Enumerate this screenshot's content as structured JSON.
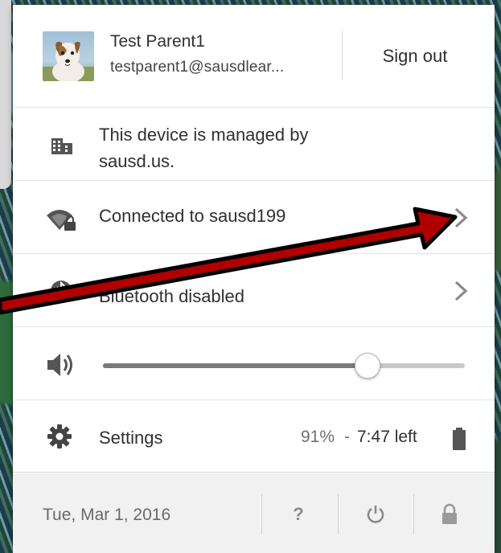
{
  "user": {
    "name": "Test Parent1",
    "email": "testparent1@sausdlear...",
    "sign_out_label": "Sign out"
  },
  "managed": {
    "text": "This device is managed by sausd.us.",
    "icon": "building-icon"
  },
  "network": {
    "label": "Connected to sausd199",
    "icon": "wifi-lock-icon"
  },
  "bluetooth": {
    "label": "Bluetooth disabled",
    "icon": "bluetooth-disabled-icon"
  },
  "volume": {
    "icon": "speaker-icon",
    "level": 0.73
  },
  "settings": {
    "label": "Settings",
    "battery_percent": "91%",
    "separator": "-",
    "battery_time": "7:47 left"
  },
  "footer": {
    "date": "Tue, Mar 1, 2016",
    "help_glyph": "?",
    "power_icon": "power-icon",
    "lock_icon": "lock-icon"
  },
  "colors": {
    "text": "#303030",
    "muted": "#707070",
    "arrow": "#b00000",
    "footer_bg": "#f1f1f1"
  }
}
